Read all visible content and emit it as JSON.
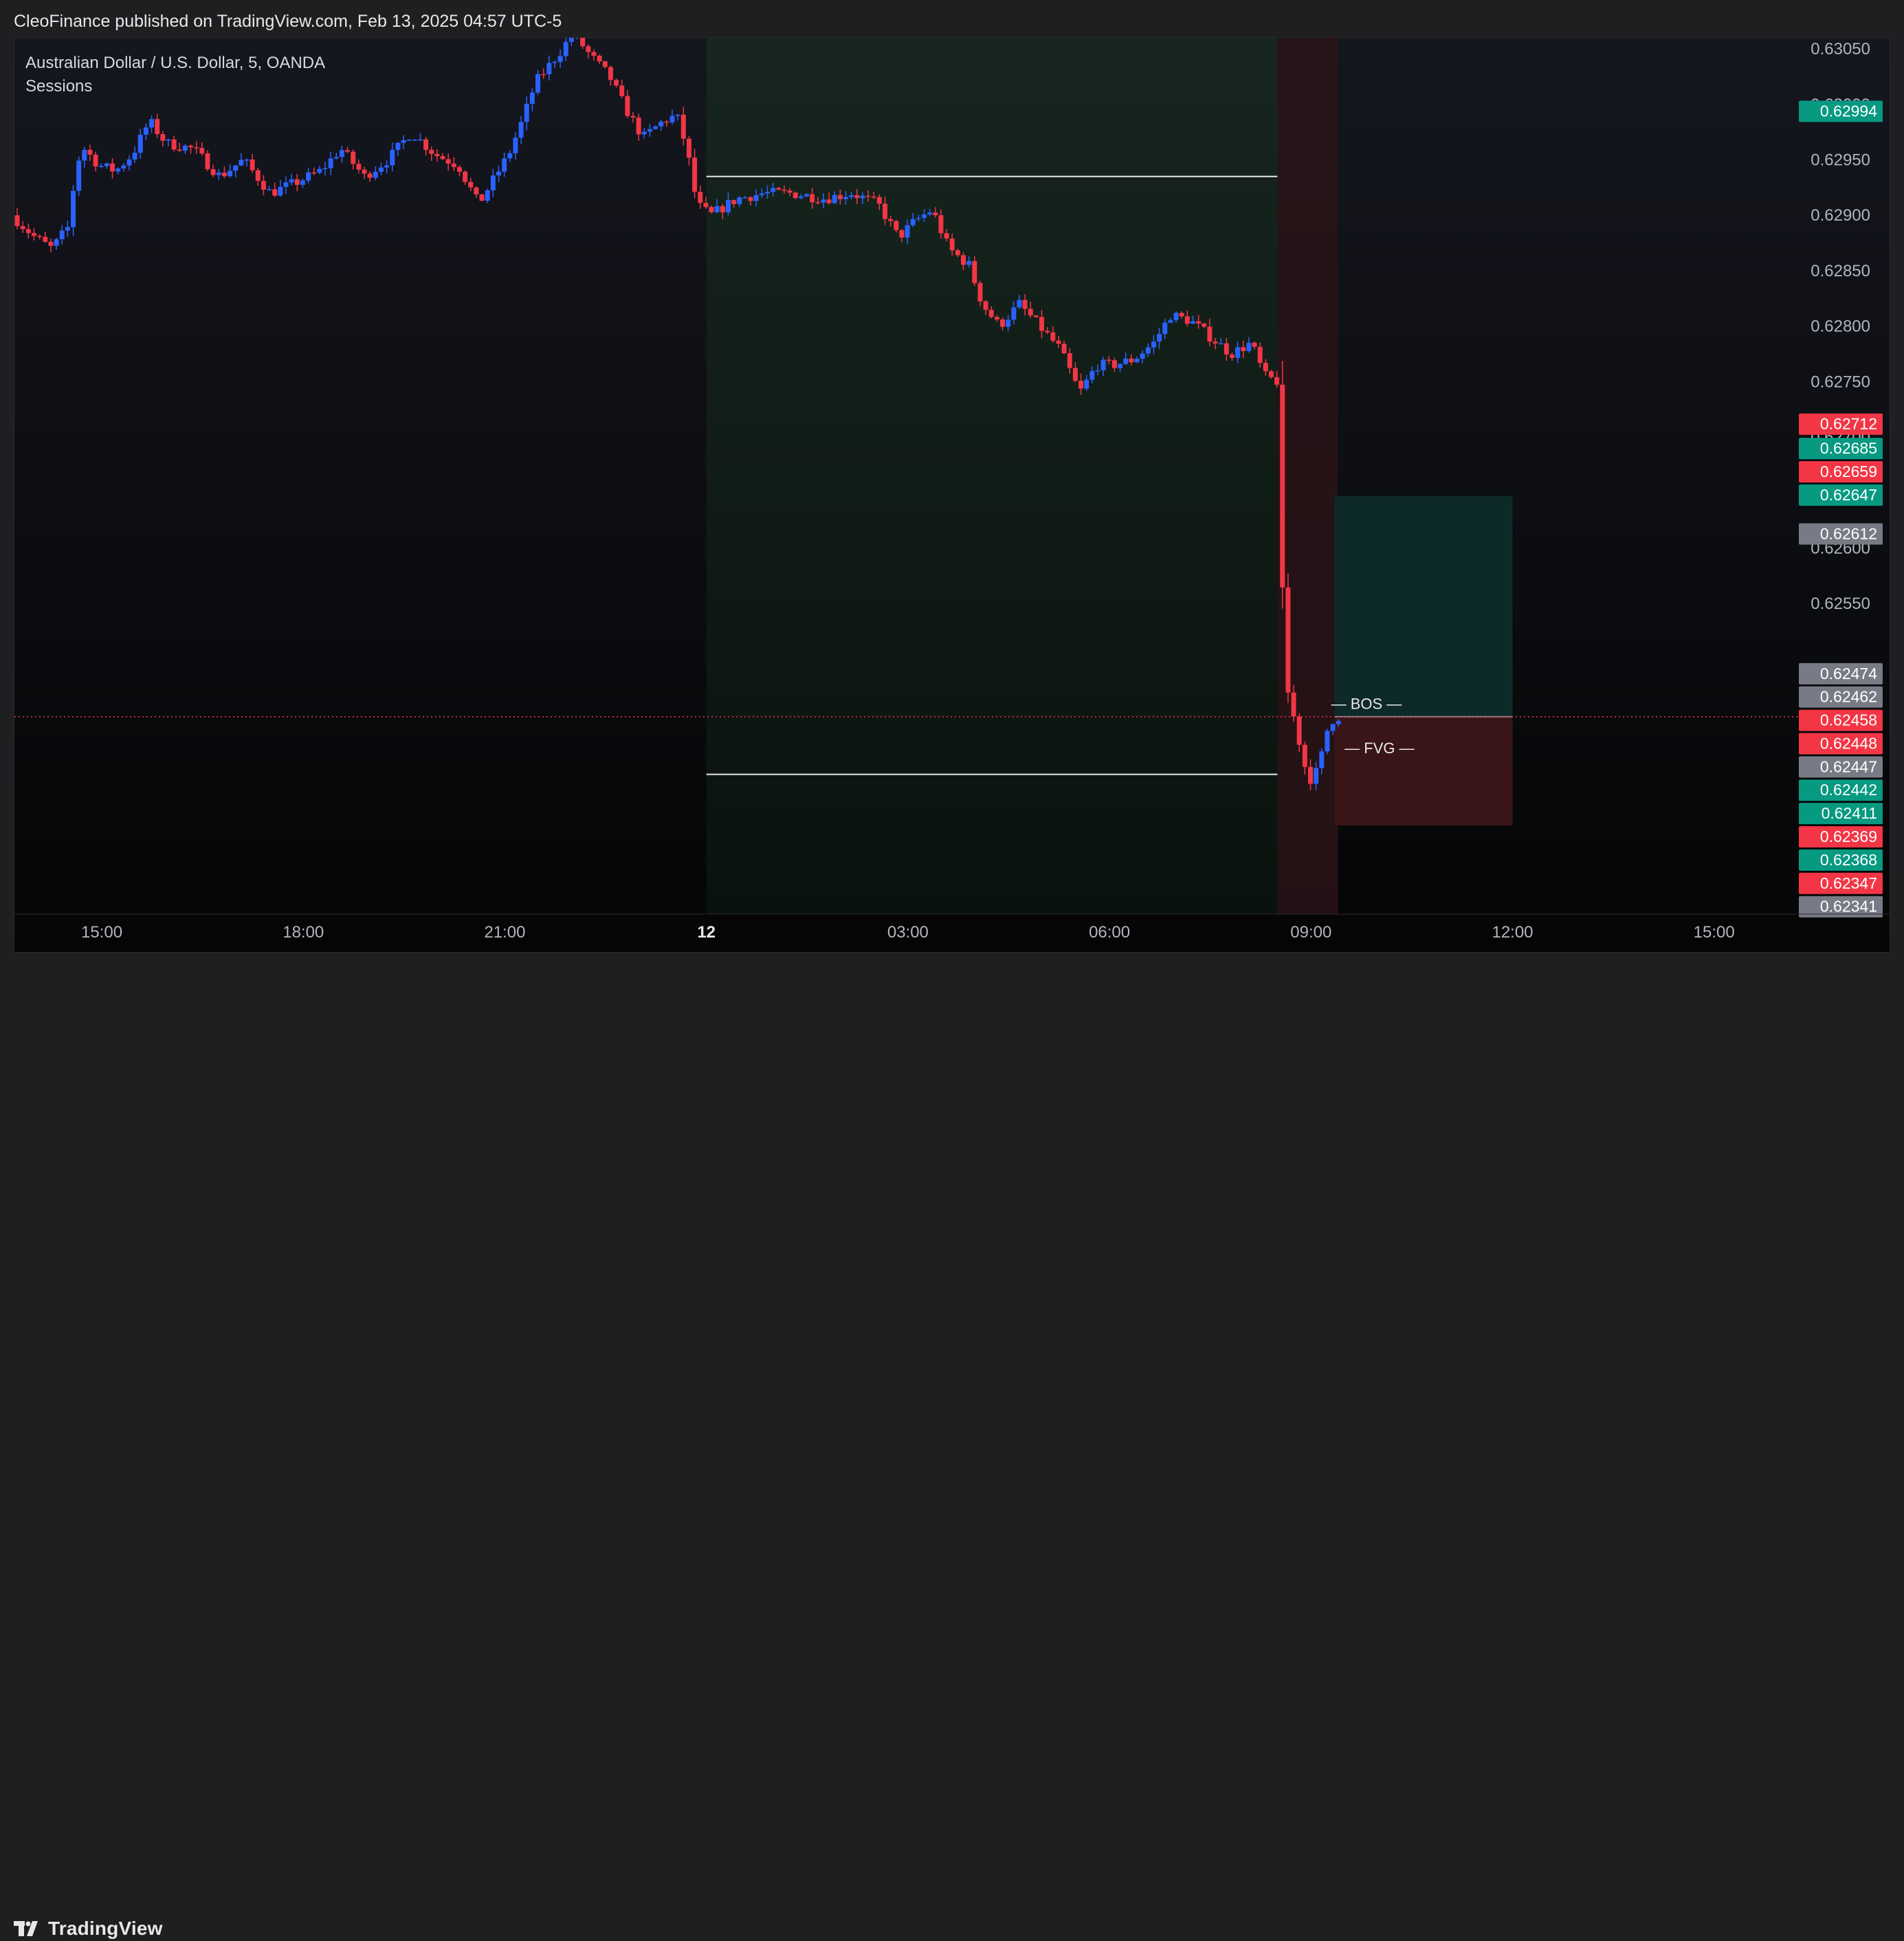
{
  "header": {
    "published": "CleoFinance published on TradingView.com, Feb 13, 2025 04:57 UTC-5"
  },
  "brand": {
    "name": "TradingView"
  },
  "colors": {
    "up": "#2962ff",
    "down": "#f23645",
    "bg": "#0d0e12",
    "asia_session": "#0f1f1a",
    "london_session": "#2a1418",
    "tp_zone": "#0e2a28",
    "sl_zone": "#3a1518"
  },
  "chart_data": {
    "type": "candlestick",
    "title": "Australian Dollar / U.S. Dollar, 5, OANDA",
    "indicator": "Sessions",
    "ylim": [
      0.6227,
      0.6306
    ],
    "y_ticks": [
      "0.63050",
      "0.63000",
      "0.62950",
      "0.62900",
      "0.62850",
      "0.62800",
      "0.62750",
      "0.62700",
      "0.62650",
      "0.62600",
      "0.62550"
    ],
    "x_ticks": [
      {
        "label": "15:00",
        "h": 15
      },
      {
        "label": "18:00",
        "h": 18
      },
      {
        "label": "21:00",
        "h": 21
      },
      {
        "label": "12",
        "h": 24,
        "bold": true
      },
      {
        "label": "03:00",
        "h": 27
      },
      {
        "label": "06:00",
        "h": 30
      },
      {
        "label": "09:00",
        "h": 33
      },
      {
        "label": "12:00",
        "h": 36
      },
      {
        "label": "15:00",
        "h": 39
      }
    ],
    "xlim_hours": [
      13.7,
      40.2
    ],
    "sessions": [
      {
        "name": "asia",
        "start_h": 24.0,
        "end_h": 32.5
      },
      {
        "name": "london",
        "start_h": 32.5,
        "end_h": 33.4
      }
    ],
    "range_lines": [
      {
        "price": 0.62935,
        "start_h": 24.0,
        "end_h": 32.5
      },
      {
        "price": 0.62396,
        "start_h": 24.0,
        "end_h": 32.5
      }
    ],
    "annotations": [
      {
        "text": "BOS",
        "price": 0.6246,
        "h": 33.3
      },
      {
        "text": "FVG",
        "price": 0.6242,
        "h": 33.5
      }
    ],
    "position": {
      "entry": 0.62448,
      "tp": 0.62647,
      "sl": 0.6235,
      "start_h": 33.35,
      "end_h": 36.0
    },
    "current_price": 0.62448,
    "price_labels": [
      {
        "text": "0.62994",
        "price": 0.62994,
        "kind": "up"
      },
      {
        "text": "0.62712",
        "price": 0.62712,
        "kind": "down"
      },
      {
        "text": "0.62685",
        "price": 0.6269,
        "kind": "up"
      },
      {
        "text": "0.62659",
        "price": 0.62669,
        "kind": "down"
      },
      {
        "text": "0.62647",
        "price": 0.62648,
        "kind": "up"
      },
      {
        "text": "0.62612",
        "price": 0.62613,
        "kind": "gray"
      },
      {
        "text": "0.62474",
        "price": 0.62487,
        "kind": "gray"
      },
      {
        "text": "0.62462",
        "price": 0.62466,
        "kind": "gray"
      },
      {
        "text": "0.62458",
        "price": 0.62445,
        "kind": "down"
      },
      {
        "text": "0.62448",
        "price": 0.62424,
        "kind": "down"
      },
      {
        "text": "0.62447",
        "price": 0.62403,
        "kind": "gray"
      },
      {
        "text": "0.62442",
        "price": 0.62382,
        "kind": "up"
      },
      {
        "text": "0.62411",
        "price": 0.62361,
        "kind": "up"
      },
      {
        "text": "0.62369",
        "price": 0.6234,
        "kind": "down"
      },
      {
        "text": "0.62368",
        "price": 0.62319,
        "kind": "up"
      },
      {
        "text": "0.62347",
        "price": 0.62298,
        "kind": "down"
      },
      {
        "text": "0.62341",
        "price": 0.62277,
        "kind": "gray"
      }
    ],
    "price_path": [
      [
        13.7,
        0.629
      ],
      [
        14.05,
        0.6288
      ],
      [
        14.3,
        0.6287
      ],
      [
        14.55,
        0.6289
      ],
      [
        14.65,
        0.6294
      ],
      [
        14.75,
        0.62962
      ],
      [
        15.0,
        0.62945
      ],
      [
        15.25,
        0.6294
      ],
      [
        15.5,
        0.62955
      ],
      [
        15.75,
        0.62985
      ],
      [
        16.0,
        0.62965
      ],
      [
        16.4,
        0.6296
      ],
      [
        16.8,
        0.62935
      ],
      [
        17.15,
        0.6295
      ],
      [
        17.55,
        0.6292
      ],
      [
        17.95,
        0.6293
      ],
      [
        18.3,
        0.6294
      ],
      [
        18.6,
        0.6296
      ],
      [
        18.95,
        0.62935
      ],
      [
        19.3,
        0.6295
      ],
      [
        19.65,
        0.62975
      ],
      [
        20.0,
        0.62955
      ],
      [
        20.35,
        0.62945
      ],
      [
        20.65,
        0.6291
      ],
      [
        20.85,
        0.6293
      ],
      [
        21.1,
        0.62955
      ],
      [
        21.3,
        0.62985
      ],
      [
        21.5,
        0.6302
      ],
      [
        21.7,
        0.63035
      ],
      [
        21.9,
        0.6305
      ],
      [
        22.05,
        0.63065
      ],
      [
        22.3,
        0.63045
      ],
      [
        22.6,
        0.63025
      ],
      [
        22.85,
        0.62995
      ],
      [
        23.1,
        0.6297
      ],
      [
        23.4,
        0.62985
      ],
      [
        23.6,
        0.6299
      ],
      [
        23.75,
        0.6296
      ],
      [
        23.9,
        0.6291
      ],
      [
        24.1,
        0.629
      ],
      [
        24.5,
        0.62915
      ],
      [
        24.9,
        0.6292
      ],
      [
        25.3,
        0.6292
      ],
      [
        25.8,
        0.62915
      ],
      [
        26.2,
        0.6292
      ],
      [
        26.6,
        0.6291
      ],
      [
        26.9,
        0.6288
      ],
      [
        27.15,
        0.62895
      ],
      [
        27.4,
        0.62905
      ],
      [
        27.65,
        0.6287
      ],
      [
        27.95,
        0.62855
      ],
      [
        28.15,
        0.6282
      ],
      [
        28.4,
        0.628
      ],
      [
        28.7,
        0.6282
      ],
      [
        29.0,
        0.628
      ],
      [
        29.3,
        0.6278
      ],
      [
        29.6,
        0.6274
      ],
      [
        29.85,
        0.62765
      ],
      [
        30.1,
        0.62765
      ],
      [
        30.4,
        0.6277
      ],
      [
        30.7,
        0.62785
      ],
      [
        30.95,
        0.6281
      ],
      [
        31.25,
        0.62805
      ],
      [
        31.55,
        0.6279
      ],
      [
        31.85,
        0.62775
      ],
      [
        32.15,
        0.62785
      ],
      [
        32.35,
        0.62755
      ],
      [
        32.55,
        0.6275
      ],
      [
        32.62,
        0.6255
      ],
      [
        32.7,
        0.6247
      ],
      [
        32.85,
        0.6243
      ],
      [
        33.0,
        0.6239
      ],
      [
        33.15,
        0.624
      ],
      [
        33.3,
        0.6244
      ],
      [
        33.4,
        0.62448
      ]
    ]
  }
}
